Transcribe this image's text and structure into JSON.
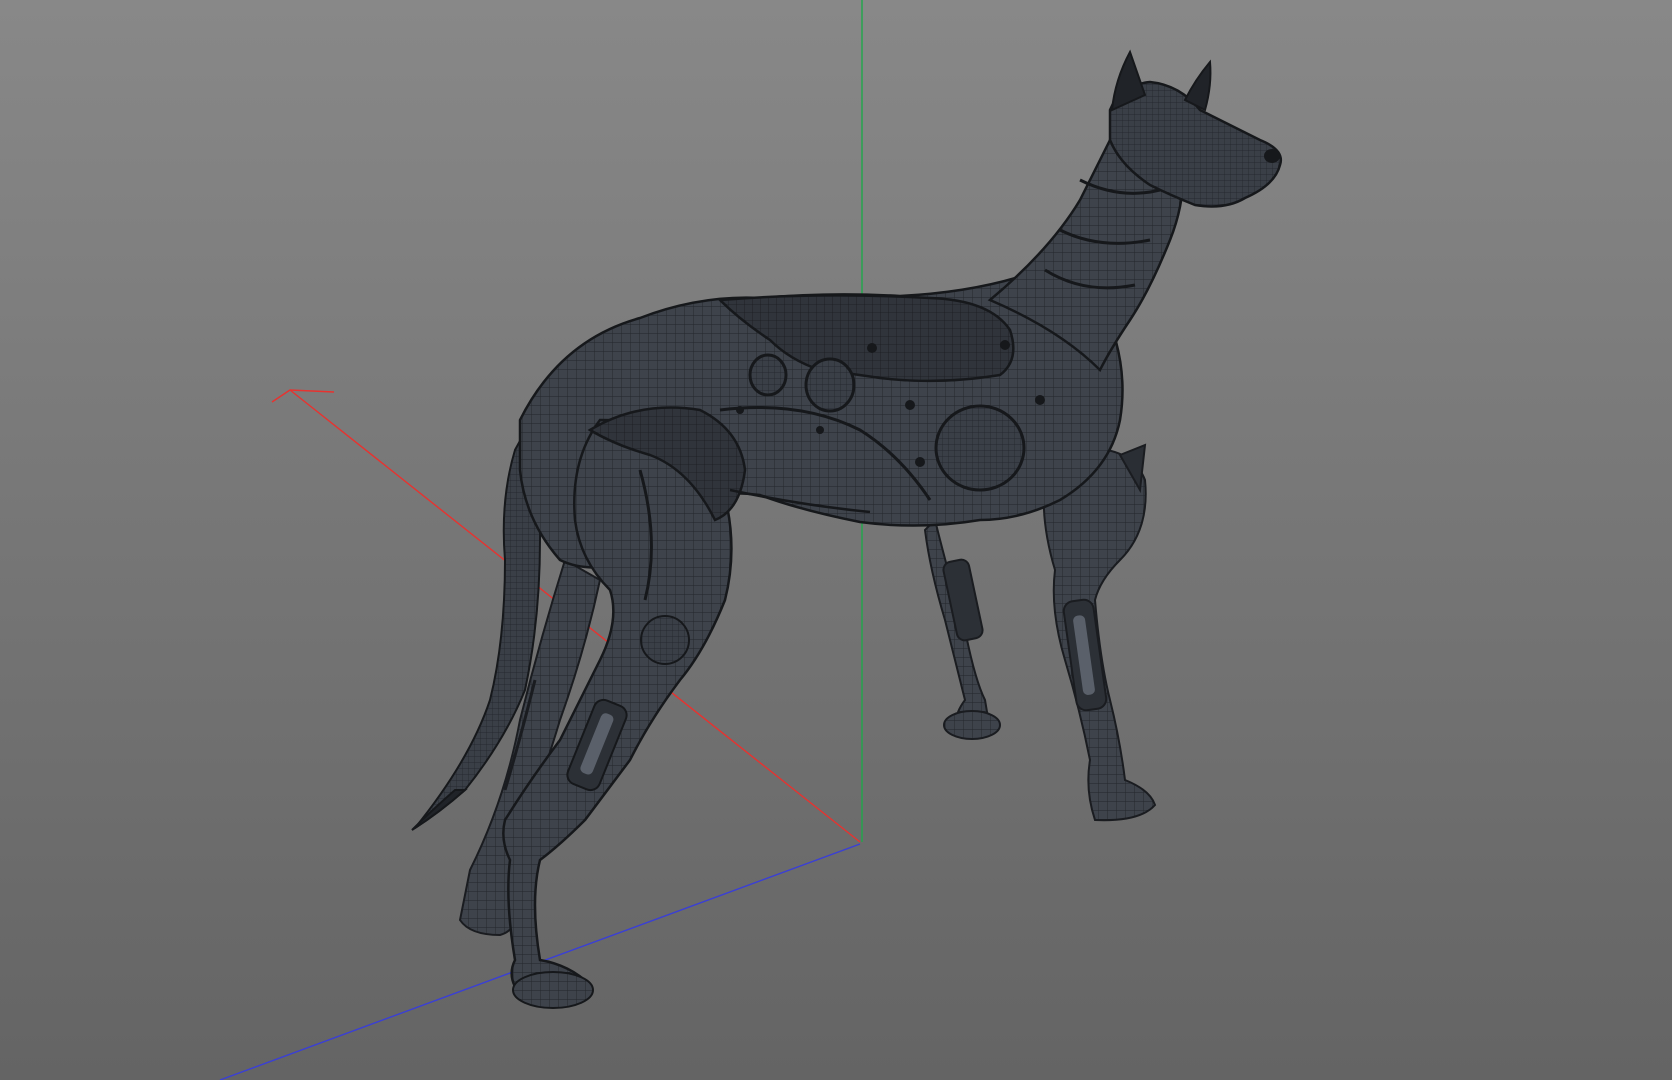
{
  "viewport": {
    "mode": "3d-perspective",
    "display": "shaded-wireframe",
    "background_top": "#888888",
    "background_bottom": "#646464"
  },
  "axes": {
    "x_color": "#e8322f",
    "y_color": "#1fa84a",
    "z_color": "#3a3fd6"
  },
  "model": {
    "subject": "robotic dog",
    "surface_color": "#3c4149",
    "edge_color": "#1a1c20",
    "joint_color": "#2a2e34"
  }
}
